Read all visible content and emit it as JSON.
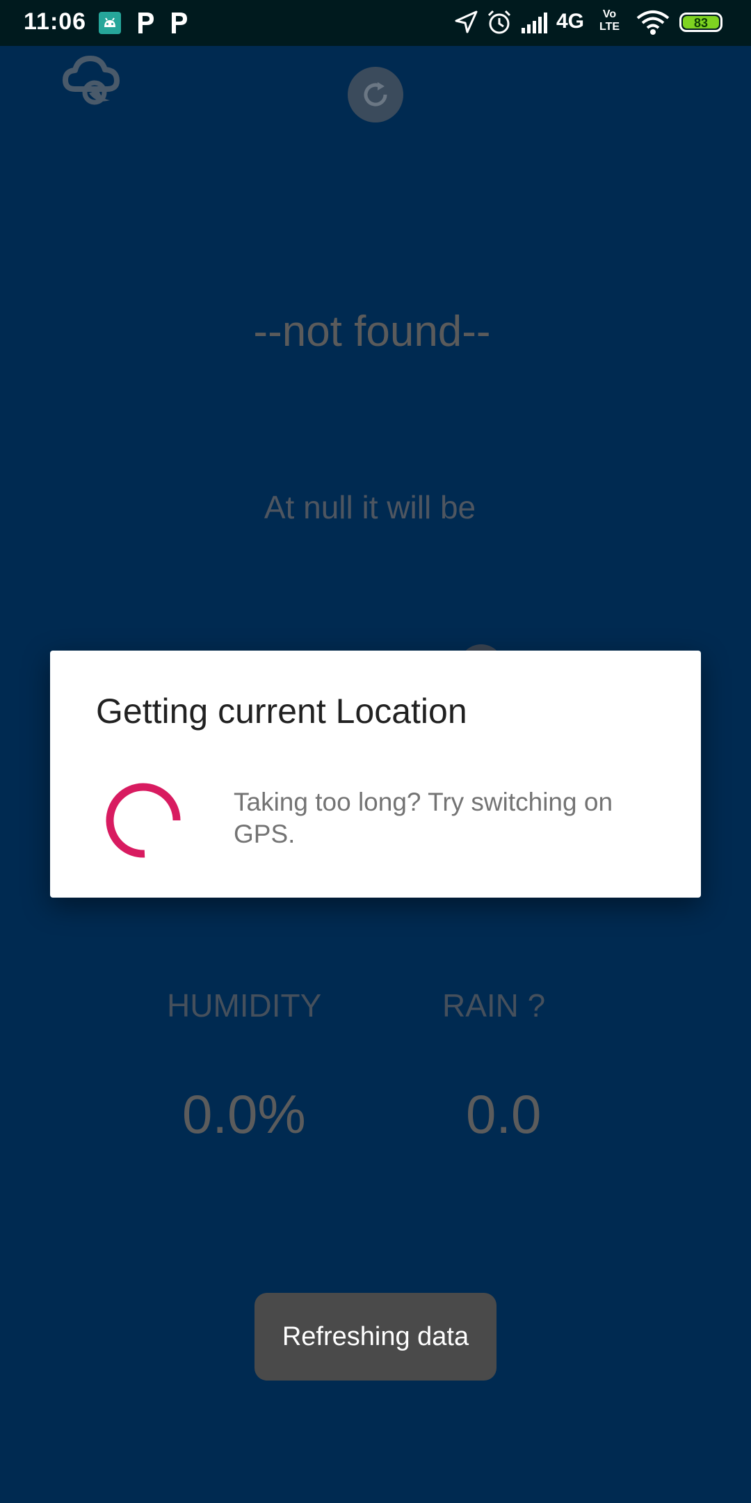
{
  "status_bar": {
    "time": "11:06",
    "network": "4G",
    "volte_top": "Vo",
    "volte_bottom": "LTE",
    "battery": "83",
    "icons": [
      "android-debug-icon",
      "p-app-icon",
      "p-app-icon",
      "location-arrow-icon",
      "alarm-icon",
      "signal-icon",
      "wifi-icon",
      "battery-icon"
    ]
  },
  "app": {
    "location": "--not found--",
    "forecast": "At null it will be",
    "humidity_label": "HUMIDITY",
    "rain_label": "RAIN ?",
    "humidity_value": "0.0%",
    "rain_value": "0.0",
    "icons": [
      "cloud-moon-icon",
      "refresh-icon"
    ]
  },
  "dialog": {
    "title": "Getting current Location",
    "message": "Taking too long? Try switching on GPS.",
    "spinner_color": "#d81b60"
  },
  "toast": {
    "text": "Refreshing data"
  },
  "colors": {
    "background": "#002a51",
    "status_bar": "#001a1e",
    "battery_fill": "#7ed321"
  }
}
